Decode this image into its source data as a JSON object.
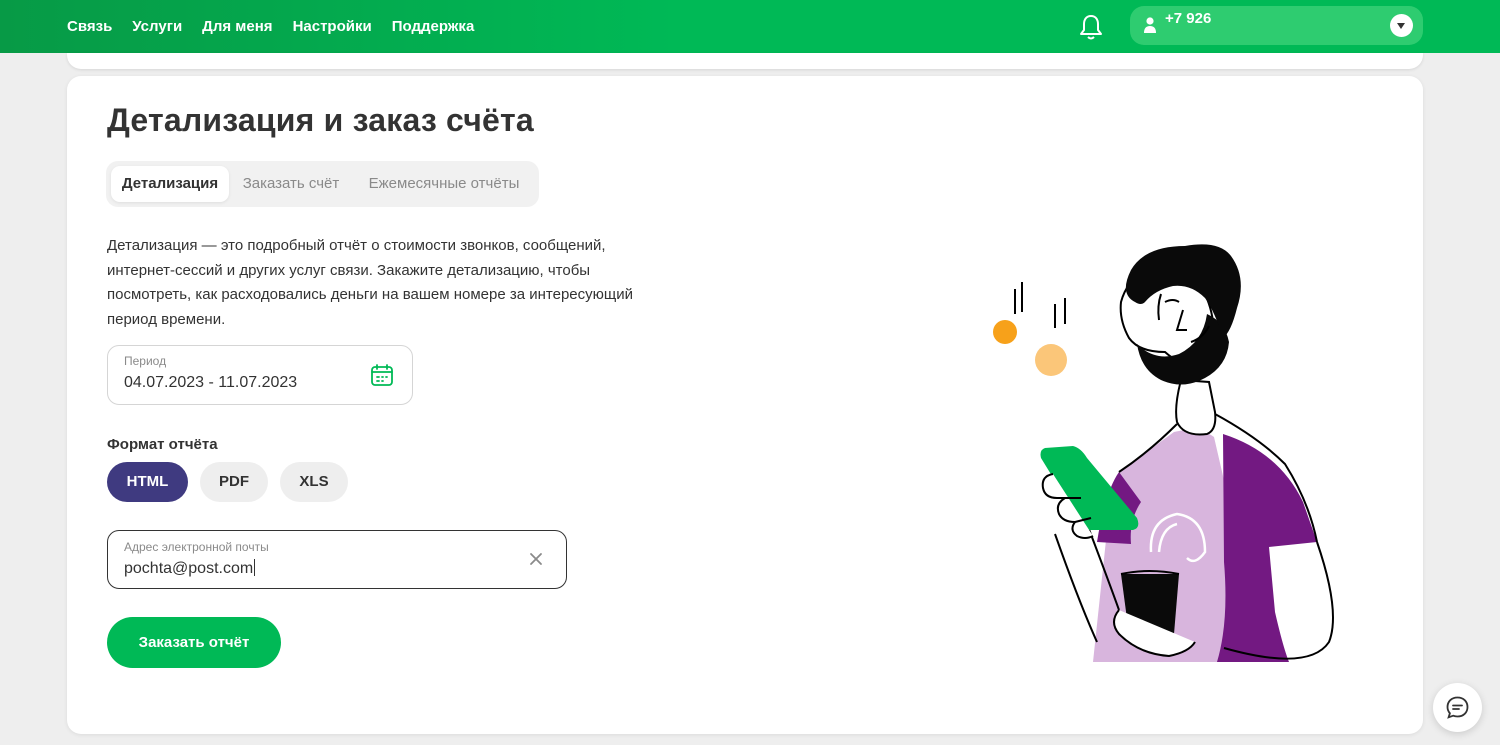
{
  "header": {
    "nav": [
      "Связь",
      "Услуги",
      "Для меня",
      "Настройки",
      "Поддержка"
    ],
    "bell_icon": "bell-icon",
    "account": {
      "phone": "+7 926",
      "user_icon": "user-icon",
      "dropdown_icon": "chevron-down-icon"
    }
  },
  "page": {
    "title": "Детализация и заказ счёта",
    "tabs": [
      {
        "label": "Детализация",
        "active": true
      },
      {
        "label": "Заказать счёт",
        "active": false
      },
      {
        "label": "Ежемесячные отчёты",
        "active": false
      }
    ],
    "description": "Детализация — это подробный отчёт о стоимости звонков, сообщений, интернет-сессий и других услуг связи. Закажите детализацию, чтобы посмотреть, как расходовались деньги на вашем номере за интересующий период времени.",
    "period": {
      "label": "Период",
      "value": "04.07.2023 - 11.07.2023",
      "icon": "calendar-icon"
    },
    "format": {
      "label": "Формат отчёта",
      "options": [
        "HTML",
        "PDF",
        "XLS"
      ],
      "selected": "HTML"
    },
    "email": {
      "label": "Адрес электронной почты",
      "value": "pochta@post.com",
      "clear_icon": "close-icon"
    },
    "submit_label": "Заказать отчёт"
  },
  "colors": {
    "brand_green": "#00b956",
    "selected_chip": "#3f3a80",
    "illustration_purple": "#731982",
    "illustration_lilac": "#d8b5dd"
  },
  "chat_icon": "chat-icon"
}
